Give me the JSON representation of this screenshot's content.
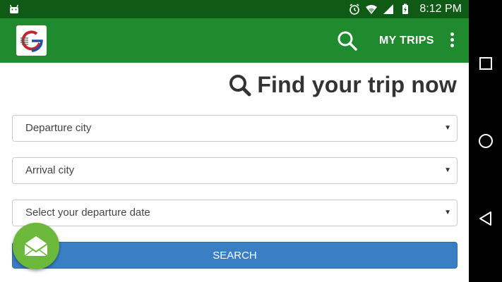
{
  "status_bar": {
    "time": "8:12 PM",
    "icons": [
      "android-icon",
      "alarm-icon",
      "wifi-icon",
      "signal-icon",
      "battery-icon"
    ]
  },
  "app_bar": {
    "logo_icon": "app-logo",
    "search_icon": "search-icon",
    "my_trips_label": "MY TRIPS",
    "overflow_icon": "more-vert-icon"
  },
  "main": {
    "heading": "Find your trip now",
    "heading_icon": "search-icon",
    "departure_placeholder": "Departure city",
    "arrival_placeholder": "Arrival city",
    "date_placeholder": "Select your departure date",
    "search_button_label": "SEARCH",
    "fab_icon": "open-envelope-icon"
  },
  "nav_bar": {
    "icons": [
      "recents-icon",
      "home-icon",
      "back-icon"
    ]
  },
  "colors": {
    "status_bar": "#0f5a14",
    "app_bar": "#1f8a2e",
    "search_button": "#3a7fc4",
    "fab": "#6cb83b"
  }
}
